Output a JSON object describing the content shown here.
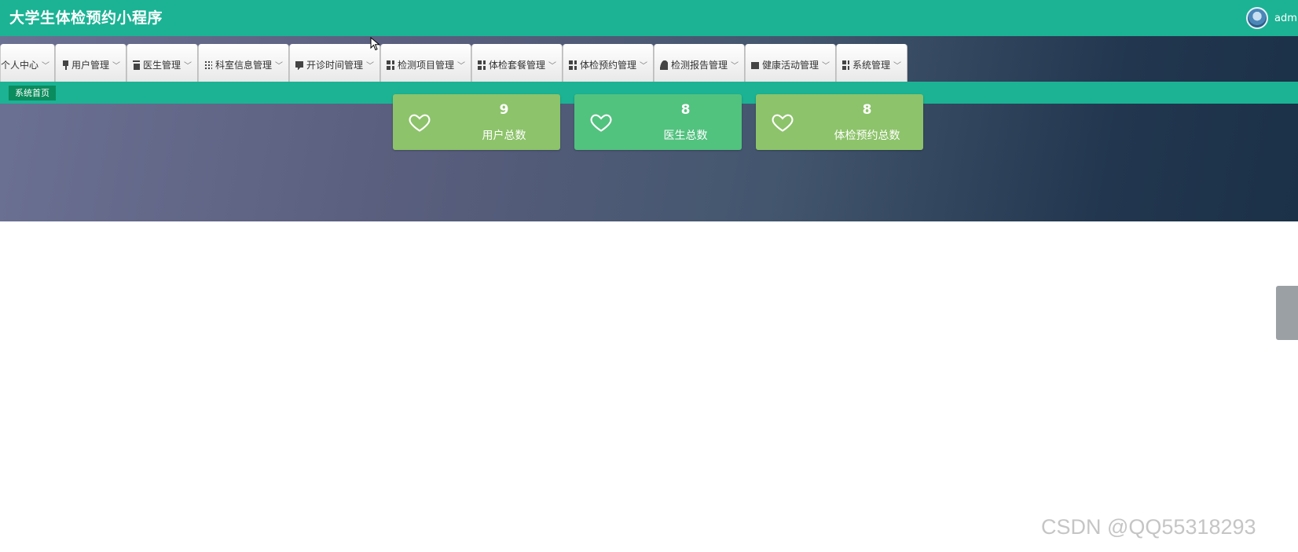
{
  "header": {
    "title": "大学生体检预约小程序",
    "username": "admin"
  },
  "nav": {
    "items": [
      {
        "label": "个人中心",
        "icon": "grid-icon"
      },
      {
        "label": "用户管理",
        "icon": "flag-icon"
      },
      {
        "label": "医生管理",
        "icon": "clipboard-icon"
      },
      {
        "label": "科室信息管理",
        "icon": "dots-icon"
      },
      {
        "label": "开诊时间管理",
        "icon": "chat-icon"
      },
      {
        "label": "检测项目管理",
        "icon": "grid-icon"
      },
      {
        "label": "体检套餐管理",
        "icon": "grid-icon"
      },
      {
        "label": "体检预约管理",
        "icon": "grid-icon"
      },
      {
        "label": "检测报告管理",
        "icon": "user-icon"
      },
      {
        "label": "健康活动管理",
        "icon": "box-icon"
      },
      {
        "label": "系统管理",
        "icon": "grid-icon"
      }
    ]
  },
  "breadcrumb": {
    "current": "系统首页"
  },
  "stats": [
    {
      "value": "9",
      "label": "用户总数",
      "color": "#8dc36a"
    },
    {
      "value": "8",
      "label": "医生总数",
      "color": "#52c27f"
    },
    {
      "value": "8",
      "label": "体检预约总数",
      "color": "#8dc36a"
    }
  ],
  "watermark": "CSDN @QQ55318293",
  "colors": {
    "primary": "#1bb394",
    "crumb": "#0b8c5e"
  }
}
